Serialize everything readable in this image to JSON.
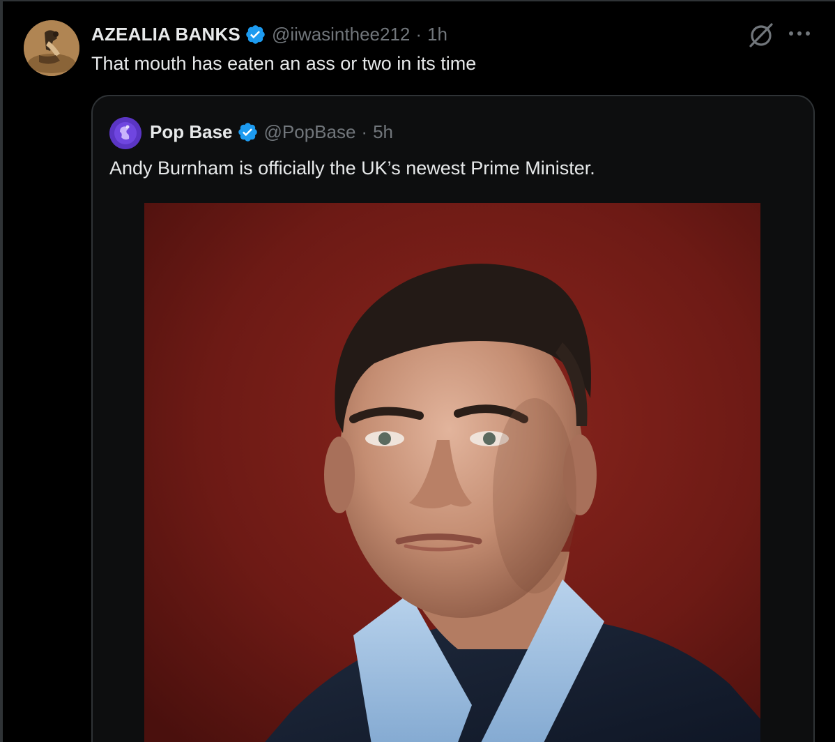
{
  "tweet": {
    "display_name": "AZEALIA BANKS",
    "handle": "@iiwasinthee212",
    "separator": "·",
    "time": "1h",
    "text": "That mouth has eaten an ass or two in its time",
    "verified_icon": "verified-badge-icon",
    "actions": {
      "grok_icon": "grok-icon",
      "more_icon": "more-options-icon"
    }
  },
  "quote": {
    "display_name": "Pop Base",
    "handle": "@PopBase",
    "separator": "·",
    "time": "5h",
    "text": "Andy Burnham is officially the UK’s newest Prime Minister.",
    "verified_icon": "verified-badge-icon",
    "media_icon": "portrait-photo"
  },
  "colors": {
    "background": "#000000",
    "card_background": "#0d0e0f",
    "border": "#2f3336",
    "text_primary": "#e7e9ea",
    "text_secondary": "#71767b",
    "verified_blue": "#1d9bf0",
    "photo_backdrop": "#6d1a15"
  }
}
